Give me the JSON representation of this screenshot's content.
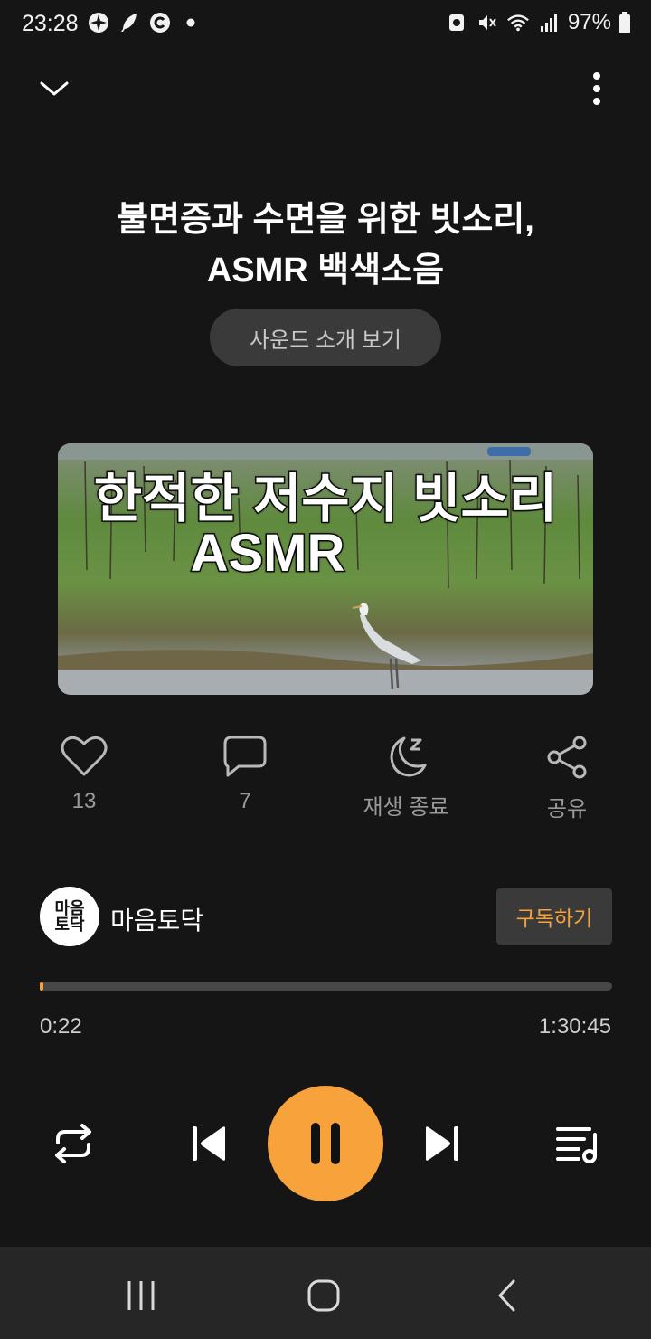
{
  "status_bar": {
    "time": "23:28",
    "battery": "97%",
    "icons": [
      "fan-icon",
      "feather-icon",
      "c-icon",
      "dot-icon",
      "screenshot-icon",
      "mute-icon",
      "wifi-icon",
      "signal-icon",
      "battery-icon"
    ]
  },
  "header": {
    "title_line1": "불면증과 수면을 위한 빗소리,",
    "title_line2": "ASMR 백색소음",
    "intro_button": "사운드 소개 보기"
  },
  "thumbnail": {
    "caption_line1": "한적한 저수지 빗소리",
    "caption_line2": "ASMR"
  },
  "actions": {
    "like_count": "13",
    "comment_count": "7",
    "sleep_timer_label": "재생 종료",
    "share_label": "공유"
  },
  "channel": {
    "name": "마음토닥",
    "avatar_text": "마음\n토닥",
    "subscribe_label": "구독하기"
  },
  "player": {
    "current_time": "0:22",
    "total_time": "1:30:45",
    "progress_fraction": 0.004
  },
  "colors": {
    "accent": "#f7a23b",
    "background": "#151515",
    "pill": "#3a3a3a"
  }
}
